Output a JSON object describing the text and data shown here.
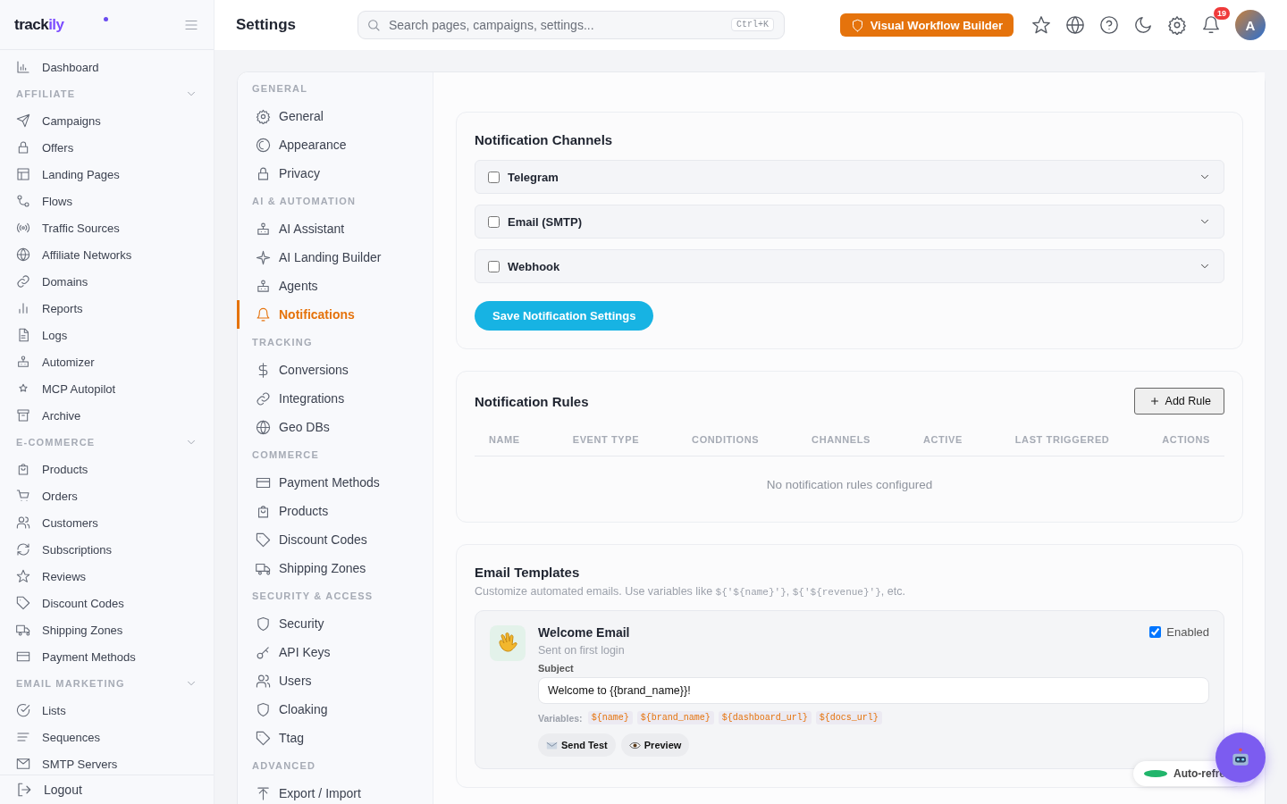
{
  "logo": {
    "main": "track",
    "accent": "ily"
  },
  "sidebar": {
    "top_items": [
      {
        "label": "Dashboard",
        "selected": false
      }
    ],
    "sections": [
      {
        "title": "AFFILIATE",
        "expanded": true,
        "items": [
          {
            "label": "Campaigns",
            "selected": false
          },
          {
            "label": "Offers",
            "selected": false
          },
          {
            "label": "Landing Pages",
            "selected": false
          },
          {
            "label": "Flows",
            "selected": false
          },
          {
            "label": "Traffic Sources",
            "selected": false
          },
          {
            "label": "Affiliate Networks",
            "selected": false
          },
          {
            "label": "Domains",
            "selected": false
          },
          {
            "label": "Reports",
            "selected": false
          },
          {
            "label": "Logs",
            "selected": false
          },
          {
            "label": "Automizer",
            "selected": false
          },
          {
            "label": "MCP Autopilot",
            "selected": false
          },
          {
            "label": "Archive",
            "selected": false
          }
        ]
      },
      {
        "title": "E-COMMERCE",
        "expanded": true,
        "items": [
          {
            "label": "Products",
            "selected": false
          },
          {
            "label": "Orders",
            "selected": false
          },
          {
            "label": "Customers",
            "selected": false
          },
          {
            "label": "Subscriptions",
            "selected": false
          },
          {
            "label": "Reviews",
            "selected": false
          },
          {
            "label": "Discount Codes",
            "selected": false
          },
          {
            "label": "Shipping Zones",
            "selected": false
          },
          {
            "label": "Payment Methods",
            "selected": false
          }
        ]
      },
      {
        "title": "EMAIL MARKETING",
        "expanded": true,
        "items": [
          {
            "label": "Lists",
            "selected": false
          },
          {
            "label": "Sequences",
            "selected": false
          },
          {
            "label": "SMTP Servers",
            "selected": false
          }
        ]
      }
    ],
    "logout": "Logout"
  },
  "topbar": {
    "title": "Settings",
    "search": {
      "placeholder": "Search pages, campaigns, settings...",
      "shortcut": "Ctrl+K"
    },
    "workflow_button": "Visual Workflow Builder",
    "notification_count": "19",
    "avatar": "A"
  },
  "settings_nav": [
    {
      "title": "GENERAL",
      "items": [
        {
          "label": "General",
          "selected": false
        },
        {
          "label": "Appearance",
          "selected": false
        },
        {
          "label": "Privacy",
          "selected": false
        }
      ]
    },
    {
      "title": "AI & AUTOMATION",
      "items": [
        {
          "label": "AI Assistant",
          "selected": false
        },
        {
          "label": "AI Landing Builder",
          "selected": false
        },
        {
          "label": "Agents",
          "selected": false
        },
        {
          "label": "Notifications",
          "selected": true
        }
      ]
    },
    {
      "title": "TRACKING",
      "items": [
        {
          "label": "Conversions",
          "selected": false
        },
        {
          "label": "Integrations",
          "selected": false
        },
        {
          "label": "Geo DBs",
          "selected": false
        }
      ]
    },
    {
      "title": "COMMERCE",
      "items": [
        {
          "label": "Payment Methods",
          "selected": false
        },
        {
          "label": "Products",
          "selected": false
        },
        {
          "label": "Discount Codes",
          "selected": false
        },
        {
          "label": "Shipping Zones",
          "selected": false
        }
      ]
    },
    {
      "title": "SECURITY & ACCESS",
      "items": [
        {
          "label": "Security",
          "selected": false
        },
        {
          "label": "API Keys",
          "selected": false
        },
        {
          "label": "Users",
          "selected": false
        },
        {
          "label": "Cloaking",
          "selected": false
        },
        {
          "label": "Ttag",
          "selected": false
        }
      ]
    },
    {
      "title": "ADVANCED",
      "items": [
        {
          "label": "Export / Import",
          "selected": false
        }
      ]
    }
  ],
  "channels": {
    "title": "Notification Channels",
    "items": [
      {
        "label": "Telegram",
        "checked": false
      },
      {
        "label": "Email (SMTP)",
        "checked": false
      },
      {
        "label": "Webhook",
        "checked": false
      }
    ],
    "save_button": "Save Notification Settings"
  },
  "rules": {
    "title": "Notification Rules",
    "add_button": "Add Rule",
    "columns": [
      "NAME",
      "EVENT TYPE",
      "CONDITIONS",
      "CHANNELS",
      "ACTIVE",
      "LAST TRIGGERED",
      "ACTIONS"
    ],
    "empty": "No notification rules configured"
  },
  "templates": {
    "title": "Email Templates",
    "description": [
      {
        "kind": "text",
        "text": "Customize automated emails. Use variables like "
      },
      {
        "kind": "code",
        "text": "${'${name}'}"
      },
      {
        "kind": "text",
        "text": ", "
      },
      {
        "kind": "code",
        "text": "${'${revenue}'}"
      },
      {
        "kind": "text",
        "text": ", etc."
      }
    ],
    "items": [
      {
        "name": "Welcome Email",
        "trigger": "Sent on first login",
        "enabled": true,
        "enabled_label": "Enabled",
        "subject_label": "Subject",
        "subject": "Welcome to {{brand_name}}!",
        "variables_label": "Variables:",
        "variables": [
          "${name}",
          "${brand_name}",
          "${dashboard_url}",
          "${docs_url}"
        ],
        "actions": [
          "Send Test",
          "Preview"
        ]
      }
    ]
  },
  "auto_refresh": {
    "label": "Auto-refre",
    "active": true
  }
}
